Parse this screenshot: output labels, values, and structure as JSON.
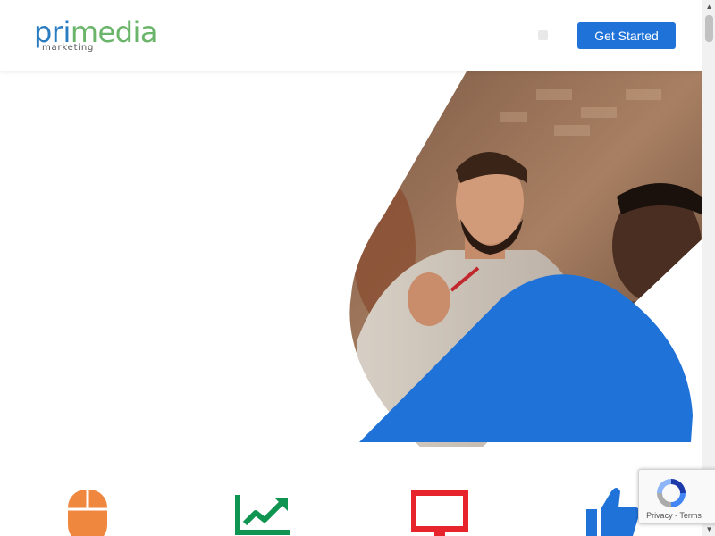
{
  "header": {
    "logo": {
      "primary_part1": "pri",
      "primary_part2": "media",
      "subtitle": "marketing"
    },
    "menu_icon": "menu-toggle-icon",
    "cta_label": "Get Started"
  },
  "hero": {
    "image_description_icon": "team-photo",
    "accent_color": "#1f72d8"
  },
  "features": {
    "items": [
      {
        "icon": "mouse-icon",
        "color": "#f0873e"
      },
      {
        "icon": "trending-chart-icon",
        "color": "#109452"
      },
      {
        "icon": "monitor-icon",
        "color": "#e7232b"
      },
      {
        "icon": "thumbs-up-icon",
        "color": "#1f72d8"
      }
    ]
  },
  "recaptcha": {
    "privacy_label": "Privacy",
    "separator": " - ",
    "terms_label": "Terms"
  },
  "scrollbar": {
    "up_arrow": "▲",
    "down_arrow": "▼"
  }
}
